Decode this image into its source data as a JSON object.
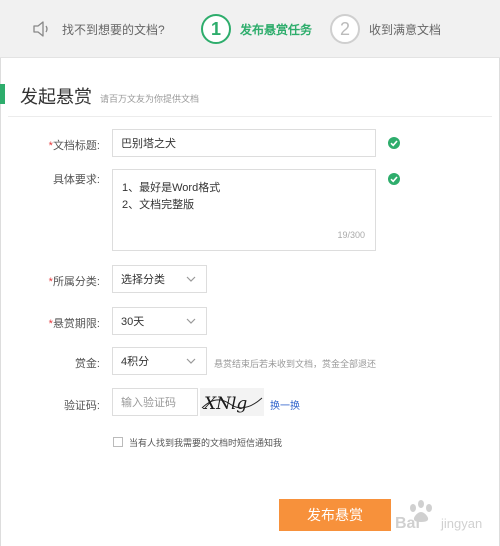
{
  "steps": [
    {
      "label": "找不到想要的文档?",
      "icon": "speaker-icon"
    },
    {
      "number": "1",
      "label": "发布悬赏任务"
    },
    {
      "number": "2",
      "label": "收到满意文档"
    }
  ],
  "header": {
    "title": "发起悬赏",
    "subtitle": "请百万文友为你提供文档"
  },
  "form": {
    "doc_title": {
      "label": "文档标题:",
      "value": "巴别塔之犬"
    },
    "requirements": {
      "label": "具体要求:",
      "line1": "1、最好是Word格式",
      "line2": "2、文档完整版",
      "counter": "19/300"
    },
    "category": {
      "label": "所属分类:",
      "value": "选择分类"
    },
    "period": {
      "label": "悬赏期限:",
      "value": "30天"
    },
    "reward": {
      "label": "赏金:",
      "value": "4积分",
      "hint": "悬赏结束后若未收到文档，赏金全部退还"
    },
    "captcha": {
      "label": "验证码:",
      "placeholder": "输入验证码",
      "image_text": "XNlg",
      "refresh": "换一换"
    },
    "notify": {
      "label": "当有人找到我需要的文档时短信通知我",
      "checked": false
    },
    "submit": "发布悬赏"
  },
  "watermark": "Baidu 经验",
  "colors": {
    "accent": "#2ead6c",
    "button": "#f7913b",
    "required": "#e4393c",
    "link": "#3366cc"
  }
}
